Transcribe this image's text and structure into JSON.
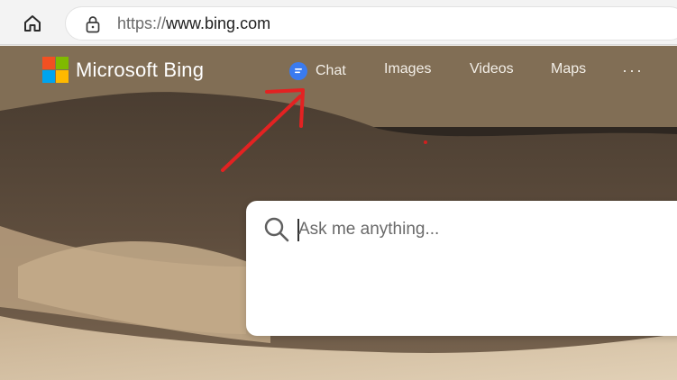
{
  "browser": {
    "url_scheme": "https://",
    "url_host": "www.bing.com"
  },
  "bing": {
    "brand": "Microsoft Bing",
    "logo_colors": [
      "#f25022",
      "#7fba00",
      "#00a4ef",
      "#ffb900"
    ],
    "nav": [
      {
        "label": "Chat",
        "icon": "chat-icon"
      },
      {
        "label": "Images"
      },
      {
        "label": "Videos"
      },
      {
        "label": "Maps"
      },
      {
        "label": "···",
        "icon": "more-icon"
      }
    ]
  },
  "search": {
    "placeholder": "Ask me anything...",
    "value": ""
  },
  "colors": {
    "annotation_arrow": "#e32222",
    "chat_icon": "#3a7bf0"
  }
}
